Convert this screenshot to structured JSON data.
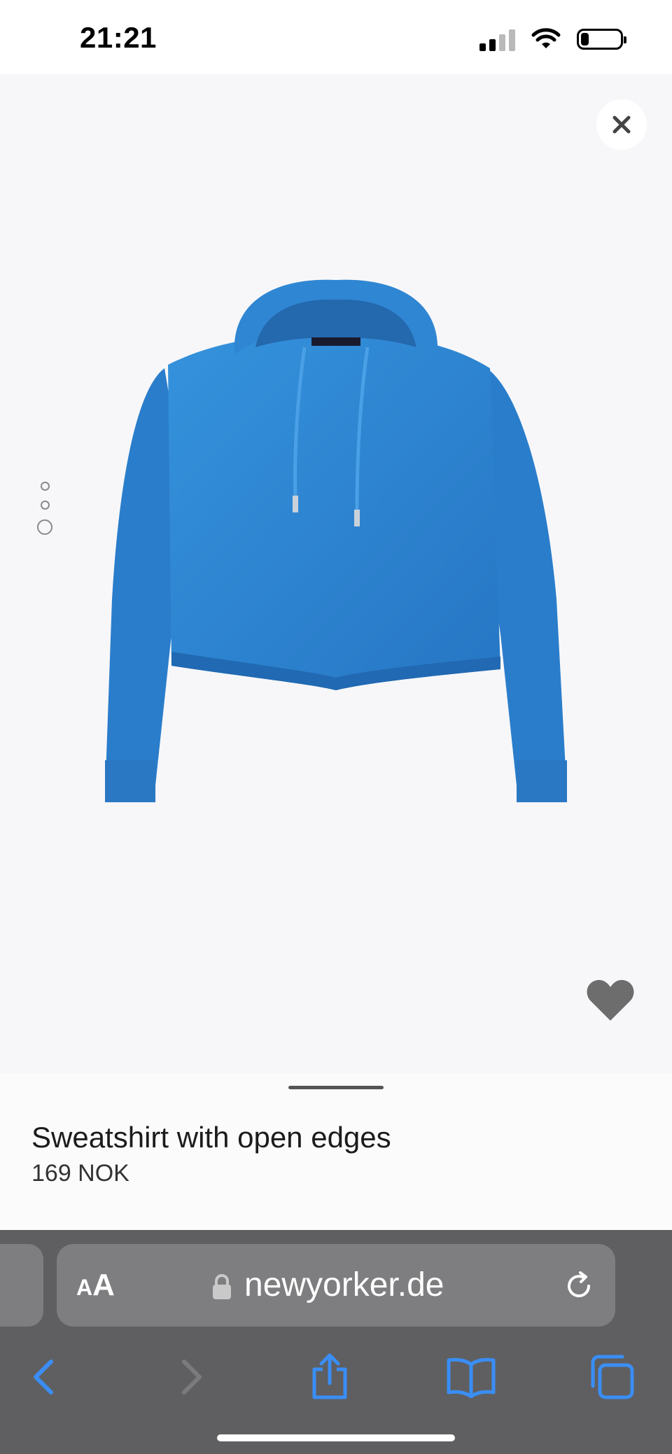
{
  "status_bar": {
    "time": "21:21",
    "icons": [
      "cellular-signal-icon",
      "wifi-icon",
      "battery-icon"
    ],
    "battery_level": 0.2,
    "signal_bars_active": 2
  },
  "gallery": {
    "close_icon": "close-icon",
    "image_count": 3,
    "active_index": 2,
    "wishlist_icon": "heart-icon",
    "product_color": "#2f86d3"
  },
  "product": {
    "title": "Sweatshirt with open edges",
    "price": "169 NOK"
  },
  "browser": {
    "text_size_label_small": "A",
    "text_size_label_large": "A",
    "url": "newyorker.de",
    "icons": [
      "lock-icon",
      "reload-icon",
      "back-icon",
      "forward-icon",
      "share-icon",
      "bookmarks-icon",
      "tabs-icon"
    ],
    "accent_color": "#3a8ef6"
  }
}
